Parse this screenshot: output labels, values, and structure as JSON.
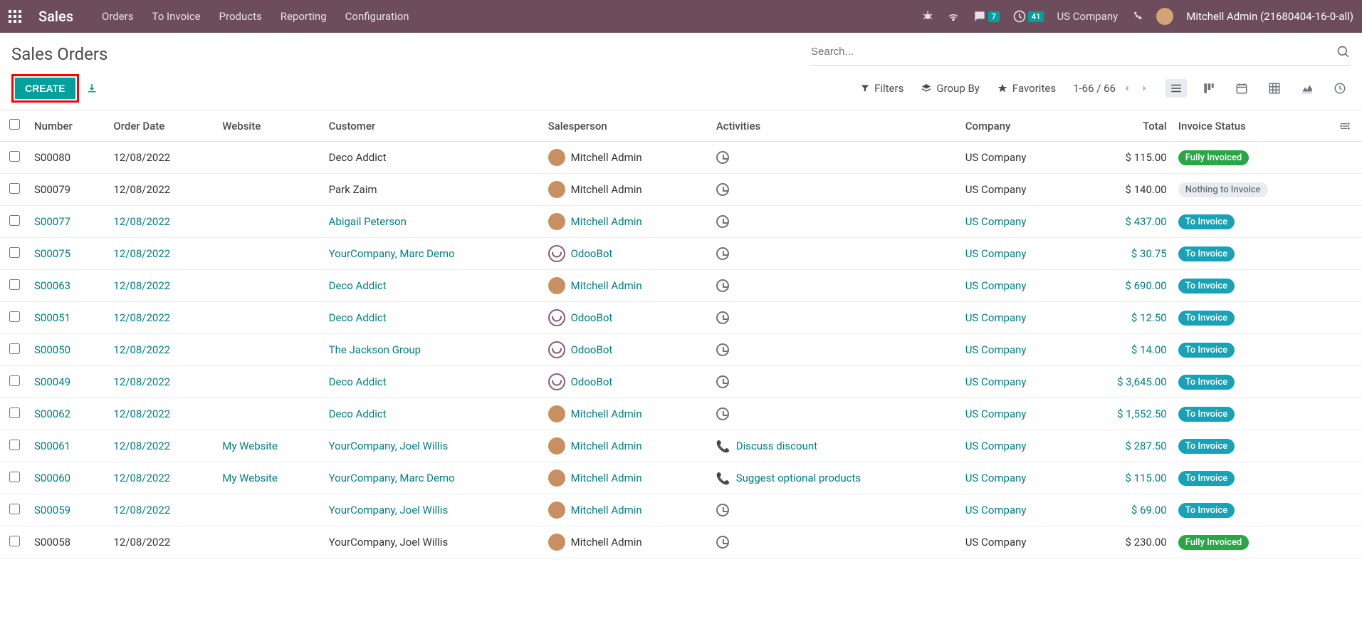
{
  "navbar": {
    "brand": "Sales",
    "menu": [
      "Orders",
      "To Invoice",
      "Products",
      "Reporting",
      "Configuration"
    ],
    "msg_badge": "7",
    "activity_badge": "41",
    "company": "US Company",
    "user": "Mitchell Admin (21680404-16-0-all)"
  },
  "cp": {
    "title": "Sales Orders",
    "search_placeholder": "Search...",
    "create": "CREATE",
    "filters": "Filters",
    "groupby": "Group By",
    "favorites": "Favorites",
    "pager": "1-66 / 66"
  },
  "columns": {
    "number": "Number",
    "order_date": "Order Date",
    "website": "Website",
    "customer": "Customer",
    "salesperson": "Salesperson",
    "activities": "Activities",
    "company": "Company",
    "total": "Total",
    "invoice_status": "Invoice Status"
  },
  "status_labels": {
    "fully": "Fully Invoiced",
    "to": "To Invoice",
    "nothing": "Nothing to Invoice"
  },
  "rows": [
    {
      "number": "S00080",
      "date": "12/08/2022",
      "website": "",
      "customer": "Deco Addict",
      "sp": "Mitchell Admin",
      "sp_bot": false,
      "act_type": "clock",
      "act_text": "",
      "company": "US Company",
      "total": "$ 115.00",
      "status": "fully",
      "link": false
    },
    {
      "number": "S00079",
      "date": "12/08/2022",
      "website": "",
      "customer": "Park Zaim",
      "sp": "Mitchell Admin",
      "sp_bot": false,
      "act_type": "clock",
      "act_text": "",
      "company": "US Company",
      "total": "$ 140.00",
      "status": "nothing",
      "link": false
    },
    {
      "number": "S00077",
      "date": "12/08/2022",
      "website": "",
      "customer": "Abigail Peterson",
      "sp": "Mitchell Admin",
      "sp_bot": false,
      "act_type": "clock",
      "act_text": "",
      "company": "US Company",
      "total": "$ 437.00",
      "status": "to",
      "link": true
    },
    {
      "number": "S00075",
      "date": "12/08/2022",
      "website": "",
      "customer": "YourCompany, Marc Demo",
      "sp": "OdooBot",
      "sp_bot": true,
      "act_type": "clock",
      "act_text": "",
      "company": "US Company",
      "total": "$ 30.75",
      "status": "to",
      "link": true
    },
    {
      "number": "S00063",
      "date": "12/08/2022",
      "website": "",
      "customer": "Deco Addict",
      "sp": "Mitchell Admin",
      "sp_bot": false,
      "act_type": "clock",
      "act_text": "",
      "company": "US Company",
      "total": "$ 690.00",
      "status": "to",
      "link": true
    },
    {
      "number": "S00051",
      "date": "12/08/2022",
      "website": "",
      "customer": "Deco Addict",
      "sp": "OdooBot",
      "sp_bot": true,
      "act_type": "clock",
      "act_text": "",
      "company": "US Company",
      "total": "$ 12.50",
      "status": "to",
      "link": true
    },
    {
      "number": "S00050",
      "date": "12/08/2022",
      "website": "",
      "customer": "The Jackson Group",
      "sp": "OdooBot",
      "sp_bot": true,
      "act_type": "clock",
      "act_text": "",
      "company": "US Company",
      "total": "$ 14.00",
      "status": "to",
      "link": true
    },
    {
      "number": "S00049",
      "date": "12/08/2022",
      "website": "",
      "customer": "Deco Addict",
      "sp": "OdooBot",
      "sp_bot": true,
      "act_type": "clock",
      "act_text": "",
      "company": "US Company",
      "total": "$ 3,645.00",
      "status": "to",
      "link": true
    },
    {
      "number": "S00062",
      "date": "12/08/2022",
      "website": "",
      "customer": "Deco Addict",
      "sp": "Mitchell Admin",
      "sp_bot": false,
      "act_type": "clock",
      "act_text": "",
      "company": "US Company",
      "total": "$ 1,552.50",
      "status": "to",
      "link": true
    },
    {
      "number": "S00061",
      "date": "12/08/2022",
      "website": "My Website",
      "customer": "YourCompany, Joel Willis",
      "sp": "Mitchell Admin",
      "sp_bot": false,
      "act_type": "phone",
      "act_text": "Discuss discount",
      "company": "US Company",
      "total": "$ 287.50",
      "status": "to",
      "link": true
    },
    {
      "number": "S00060",
      "date": "12/08/2022",
      "website": "My Website",
      "customer": "YourCompany, Marc Demo",
      "sp": "Mitchell Admin",
      "sp_bot": false,
      "act_type": "phone",
      "act_text": "Suggest optional products",
      "company": "US Company",
      "total": "$ 115.00",
      "status": "to",
      "link": true
    },
    {
      "number": "S00059",
      "date": "12/08/2022",
      "website": "",
      "customer": "YourCompany, Joel Willis",
      "sp": "Mitchell Admin",
      "sp_bot": false,
      "act_type": "clock",
      "act_text": "",
      "company": "US Company",
      "total": "$ 69.00",
      "status": "to",
      "link": true
    },
    {
      "number": "S00058",
      "date": "12/08/2022",
      "website": "",
      "customer": "YourCompany, Joel Willis",
      "sp": "Mitchell Admin",
      "sp_bot": false,
      "act_type": "clock",
      "act_text": "",
      "company": "US Company",
      "total": "$ 230.00",
      "status": "fully",
      "link": false
    }
  ]
}
